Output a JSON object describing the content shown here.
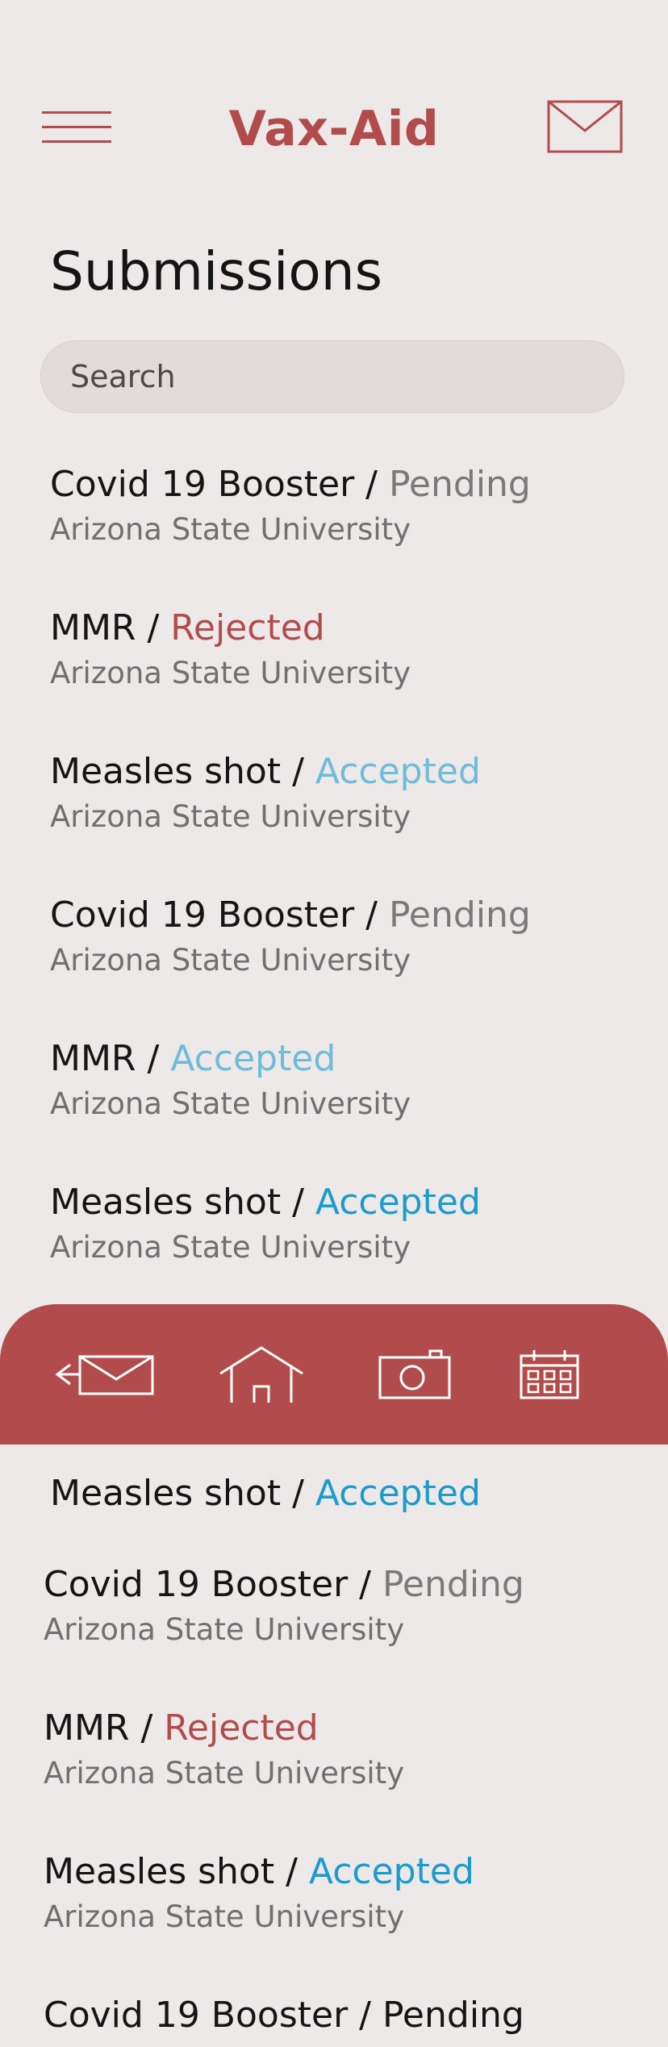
{
  "header": {
    "title": "Vax-Aid"
  },
  "page_title": "Submissions",
  "search": {
    "placeholder": "Search"
  },
  "separator": " / ",
  "items": [
    {
      "name": "Covid 19 Booster",
      "status": "Pending",
      "org": "Arizona State University"
    },
    {
      "name": "MMR",
      "status": "Rejected",
      "org": "Arizona State University"
    },
    {
      "name": "Measles shot",
      "status": "Accepted",
      "org": "Arizona State University"
    },
    {
      "name": "Covid 19 Booster",
      "status": "Pending",
      "org": "Arizona State University"
    },
    {
      "name": "MMR",
      "status": "Accepted",
      "org": "Arizona State University"
    },
    {
      "name": "Measles shot",
      "status": "Accepted",
      "org": "Arizona State University"
    },
    {
      "name": "Measles shot",
      "status": "Accepted"
    },
    {
      "name": "Covid 19 Booster",
      "status": "Pending",
      "org": "Arizona State University"
    },
    {
      "name": "MMR",
      "status": "Rejected",
      "org": "Arizona State University"
    },
    {
      "name": "Measles shot",
      "status": "Accepted",
      "org": "Arizona State University"
    },
    {
      "name": "Covid 19 Booster",
      "status": "Pending"
    }
  ],
  "colors": {
    "brand": "#b24c4c",
    "background": "#ece9e8",
    "pending": "#7a7a7a",
    "rejected": "#b24c4c",
    "accepted": "#6fbcd9",
    "accepted_strong": "#1c9bcc"
  },
  "bottom_nav": {
    "icons": [
      "mail-back-icon",
      "home-icon",
      "camera-icon",
      "calendar-icon"
    ]
  }
}
